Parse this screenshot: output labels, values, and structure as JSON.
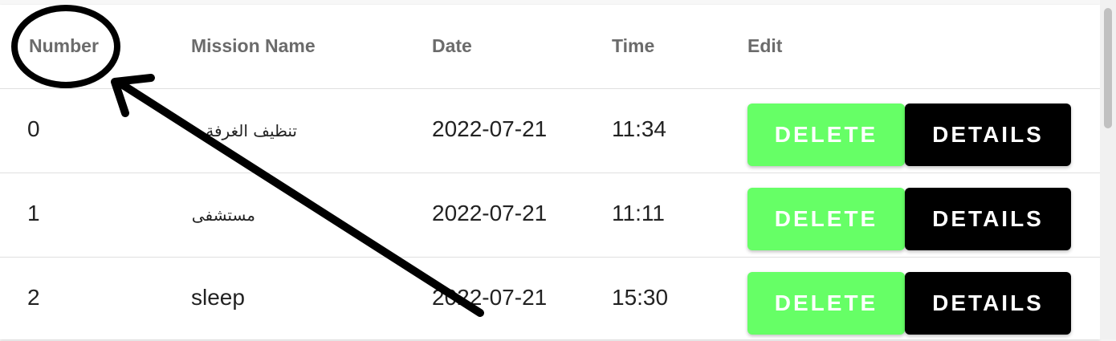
{
  "table": {
    "headers": {
      "number": "Number",
      "mission_name": "Mission Name",
      "date": "Date",
      "time": "Time",
      "edit": "Edit"
    },
    "rows": [
      {
        "number": "0",
        "mission_name": "تنظيف الغرفة",
        "date": "2022-07-21",
        "time": "11:34"
      },
      {
        "number": "1",
        "mission_name": "مستشفى",
        "date": "2022-07-21",
        "time": "11:11"
      },
      {
        "number": "2",
        "mission_name": "sleep",
        "date": "2022-07-21",
        "time": "15:30"
      }
    ],
    "delete_label": "DELETE",
    "details_label": "DETAILS"
  },
  "colors": {
    "delete_button": "#66ff66",
    "details_button": "#000000",
    "header_text": "#6b6b6b",
    "annotation": "#000000"
  },
  "annotation": {
    "type": "circle-and-arrow",
    "target": "Number header"
  }
}
